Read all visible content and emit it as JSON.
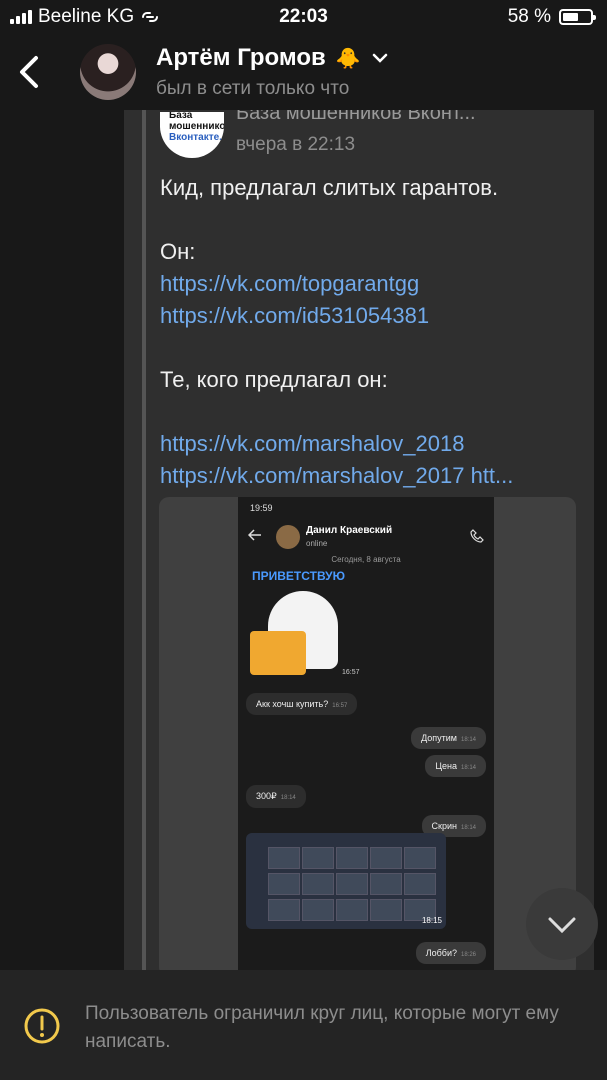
{
  "status_bar": {
    "carrier": "Beeline KG",
    "time": "22:03",
    "battery": "58 %",
    "battery_level": 0.58
  },
  "header": {
    "contact_name": "Артём Громов",
    "contact_emoji": "🐥",
    "last_seen": "был в сети только что"
  },
  "forwarded_post": {
    "source_name": "База мошенников Вконт...",
    "source_logo_line1": "База мошенников",
    "source_logo_line2": "Вконтакте.",
    "time": "вчера в 22:13",
    "line1": "Кид, предлагал слитых гарантов.",
    "label_he": "Он:",
    "link1": "https://vk.com/topgarantgg",
    "link2": "https://vk.com/id531054381",
    "label_those": "Те, кого предлагал он:",
    "link3": "https://vk.com/marshalov_2018",
    "link4": "https://vk.com/marshalov_2017 htt..."
  },
  "embedded_screenshot": {
    "status_time": "19:59",
    "contact_name": "Данил Краевский",
    "contact_status": "online",
    "date_divider": "Сегодня, 8 августа",
    "sticker_text": "ПРИВЕТСТВУЮ",
    "sticker_time": "16:57",
    "messages": [
      {
        "text": "Акк хочш купить?",
        "time": "16:57",
        "out": false
      },
      {
        "text": "Допутим",
        "time": "18:14",
        "out": true
      },
      {
        "text": "Цена",
        "time": "18:14",
        "out": true
      },
      {
        "text": "300₽",
        "time": "18:14",
        "out": false
      },
      {
        "text": "Скрин",
        "time": "18:14",
        "out": true
      },
      {
        "text": "Лобби?",
        "time": "18:26",
        "out": true
      }
    ],
    "image_time": "18:15"
  },
  "footer": {
    "notice": "Пользователь ограничил круг лиц, которые могут ему написать."
  },
  "colors": {
    "background": "#181818",
    "post_background": "#2f2f2f",
    "link": "#71aaeb",
    "muted_text": "#8d8d8d",
    "footer_background": "#242424"
  },
  "icons": [
    "back-chevron-icon",
    "chevron-down-icon",
    "warning-circle-icon",
    "scroll-down-icon"
  ]
}
